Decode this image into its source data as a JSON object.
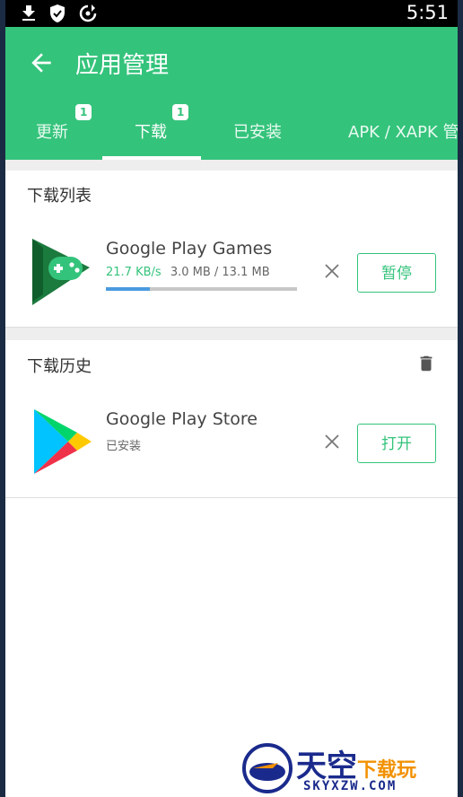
{
  "status_bar": {
    "time": "5:51",
    "icons": [
      "download-icon",
      "shield-check-icon",
      "sync-icon"
    ]
  },
  "app_bar": {
    "title": "应用管理",
    "back_icon": "arrow-left-icon",
    "color": "#34c37b"
  },
  "tabs": [
    {
      "label": "更新",
      "badge": "1",
      "selected": false
    },
    {
      "label": "下载",
      "badge": "1",
      "selected": true
    },
    {
      "label": "已安装",
      "badge": "",
      "selected": false
    },
    {
      "label": "APK / XAPK 管",
      "badge": "",
      "selected": false
    }
  ],
  "download_list": {
    "title": "下载列表",
    "items": [
      {
        "name": "Google Play Games",
        "speed": "21.7 KB/s",
        "size": "3.0 MB / 13.1 MB",
        "progress": 0.229,
        "action_label": "暂停",
        "icon": "google-play-games-icon"
      }
    ]
  },
  "download_history": {
    "title": "下载历史",
    "delete_icon": "trash-icon",
    "items": [
      {
        "name": "Google Play Store",
        "status": "已安装",
        "action_label": "打开",
        "icon": "google-play-store-icon"
      }
    ]
  },
  "watermark": {
    "text_main": "天空",
    "text_accent": "下载玩",
    "url": "SKYXZW.COM"
  }
}
